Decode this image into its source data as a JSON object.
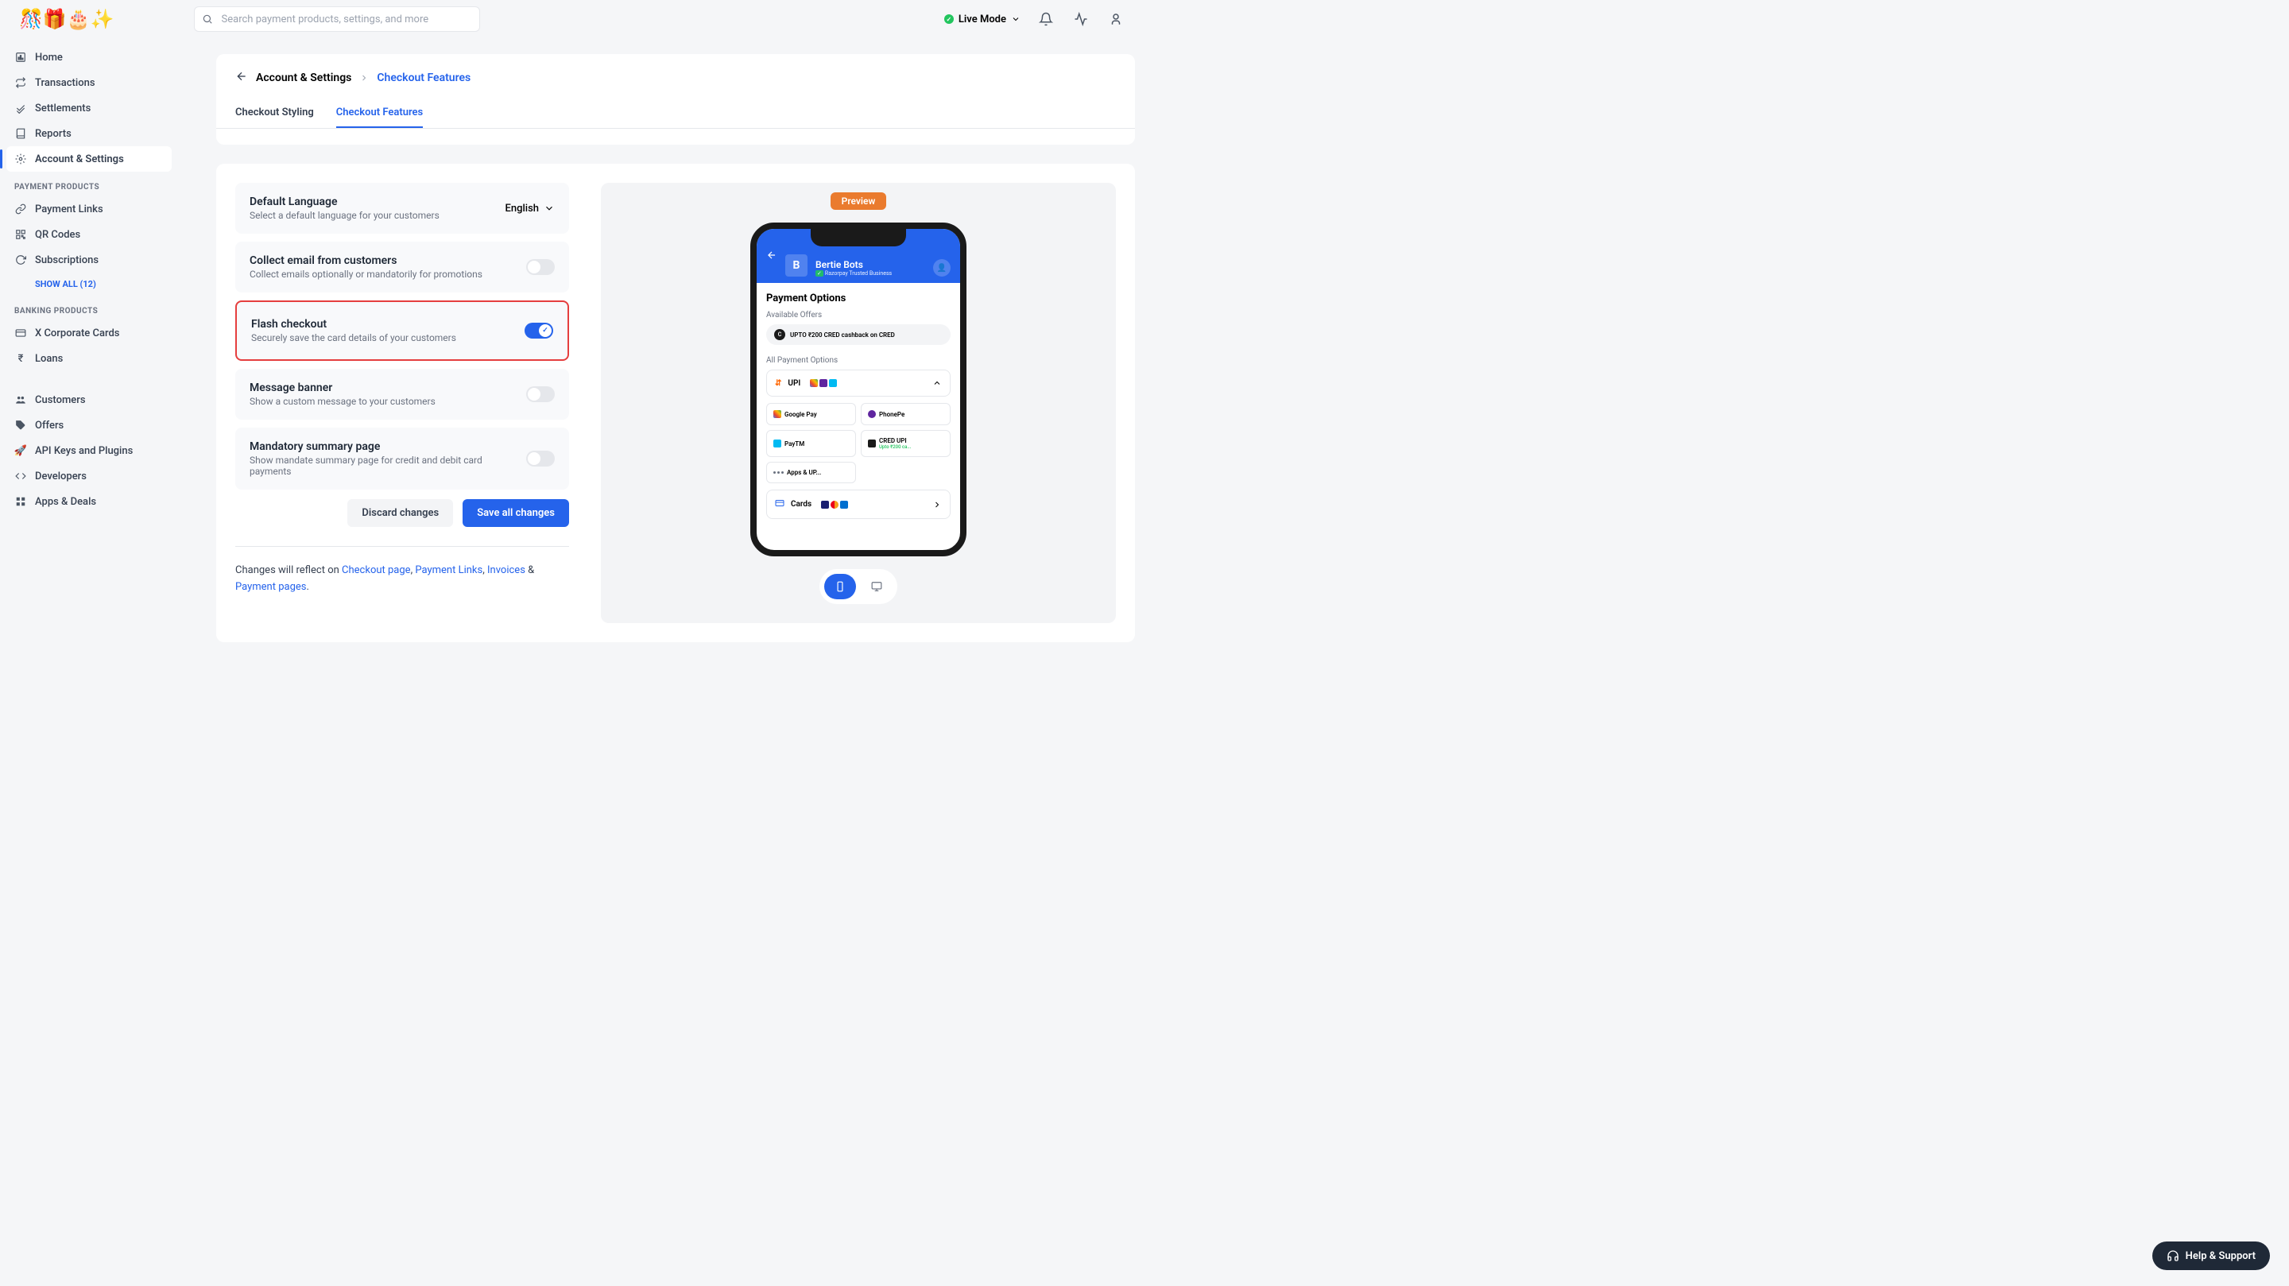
{
  "header": {
    "searchPlaceholder": "Search payment products, settings, and more",
    "liveMode": "Live Mode"
  },
  "sidebar": {
    "items": {
      "home": "Home",
      "transactions": "Transactions",
      "settlements": "Settlements",
      "reports": "Reports",
      "account": "Account & Settings",
      "paymentLinks": "Payment Links",
      "qrCodes": "QR Codes",
      "subscriptions": "Subscriptions",
      "showAll": "SHOW ALL (12)",
      "corporateCards": "X Corporate Cards",
      "loans": "Loans",
      "customers": "Customers",
      "offers": "Offers",
      "apiKeys": "API Keys and Plugins",
      "developers": "Developers",
      "appsDeals": "Apps & Deals"
    },
    "sections": {
      "paymentProducts": "PAYMENT PRODUCTS",
      "bankingProducts": "BANKING PRODUCTS"
    }
  },
  "breadcrumb": {
    "root": "Account & Settings",
    "current": "Checkout Features"
  },
  "tabs": {
    "styling": "Checkout Styling",
    "features": "Checkout Features"
  },
  "settings": {
    "language": {
      "title": "Default Language",
      "desc": "Select a default language for your customers",
      "value": "English"
    },
    "email": {
      "title": "Collect email from customers",
      "desc": "Collect emails optionally or mandatorily for promotions"
    },
    "flash": {
      "title": "Flash checkout",
      "desc": "Securely save the card details of your customers"
    },
    "banner": {
      "title": "Message banner",
      "desc": "Show a custom message to your customers"
    },
    "summary": {
      "title": "Mandatory summary page",
      "desc": "Show mandate summary page for credit and debit card payments"
    }
  },
  "buttons": {
    "discard": "Discard changes",
    "save": "Save all changes"
  },
  "footer": {
    "prefix": "Changes will reflect on ",
    "checkoutPage": "Checkout page",
    "paymentLinks": "Payment Links",
    "invoices": "Invoices",
    "paymentPages": "Payment pages"
  },
  "preview": {
    "label": "Preview",
    "merchantInitial": "B",
    "merchantName": "Bertie Bots",
    "trusted": "Razorpay Trusted Business",
    "paymentOptions": "Payment Options",
    "availableOffers": "Available Offers",
    "offerText": "UPTO ₹200 CRED cashback on CRED",
    "allPaymentOptions": "All Payment Options",
    "upi": "UPI",
    "gpay": "Google Pay",
    "phonepe": "PhonePe",
    "paytm": "PayTM",
    "credupi": "CRED UPI",
    "credsub": "Upto ₹200 ca...",
    "appsup": "Apps & UP...",
    "cards": "Cards"
  },
  "help": "Help & Support"
}
